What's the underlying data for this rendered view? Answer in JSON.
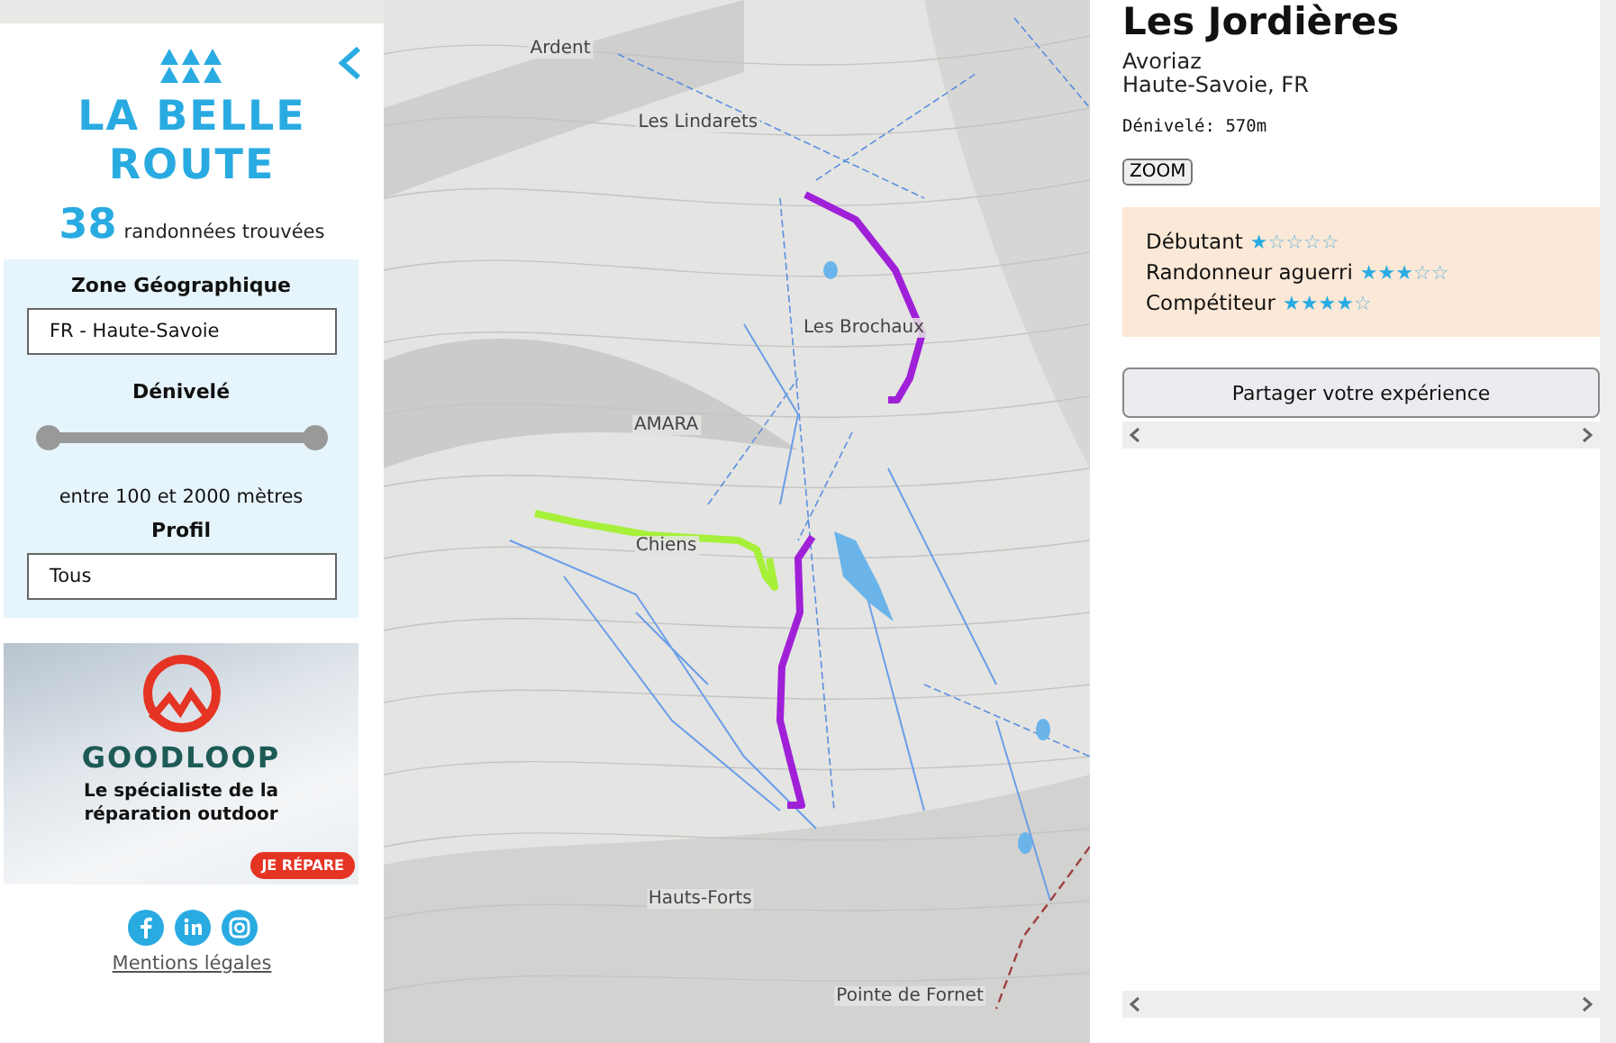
{
  "sidebar": {
    "logo": {
      "line_1": "LA BELLE",
      "line_2": "ROUTE"
    },
    "count": "38",
    "count_label": "randonnées trouvées",
    "filters": [
      {
        "kind": "select",
        "label": "Zone Géographique",
        "value": "FR - Haute-Savoie"
      },
      {
        "kind": "range",
        "label": "Dénivelé",
        "level": 1,
        "reading": "entre 100 et 2000 mètres"
      },
      {
        "kind": "select",
        "label": "Profil",
        "value": "Tous"
      }
    ],
    "ad": {
      "brand": "GOODLOOP",
      "tagline": "Le spécialiste de la réparation outdoor",
      "button": "JE RÉPARE"
    },
    "legal_link": "Mentions légales"
  },
  "map": {
    "places": [
      {
        "name": "Ardent"
      },
      {
        "name": "Les Lindarets"
      },
      {
        "name": "Les Brochaux"
      },
      {
        "name": "AMARA"
      },
      {
        "name": "Chiens"
      },
      {
        "name": "Hauts-Forts"
      },
      {
        "name": "Pointe de Fornet"
      }
    ],
    "routes": [
      {
        "color": "#a020d8"
      },
      {
        "color": "#a020d8"
      },
      {
        "color": "#a6f03a"
      }
    ]
  },
  "detail": {
    "title": "Les Jordières",
    "town": "Avoriaz",
    "region": "Haute-Savoie, FR",
    "elevation": "Dénivelé: 570m",
    "zoom_button": "ZOOM",
    "ratings": [
      {
        "label": "Débutant",
        "stars": 1
      },
      {
        "label": "Randonneur aguerri",
        "stars": 3
      },
      {
        "label": "Compétiteur",
        "stars": 4
      }
    ],
    "share_button": "Partager votre expérience"
  }
}
